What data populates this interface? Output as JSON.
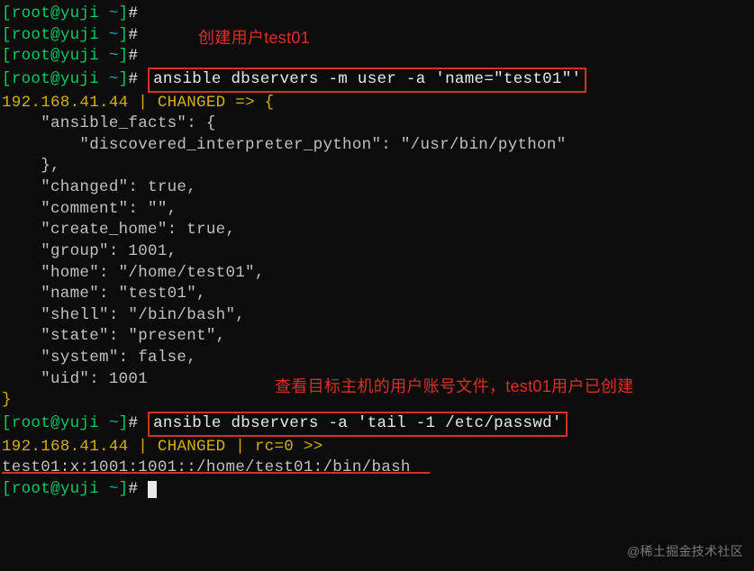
{
  "prompt": {
    "bracket_open": "[",
    "user_host": "root@yuji",
    "path": " ~",
    "bracket_close": "]",
    "hash": "# "
  },
  "annotations": {
    "create_user": "创建用户test01",
    "check_passwd": "查看目标主机的用户账号文件，test01用户已创建"
  },
  "commands": {
    "cmd1": "ansible dbservers -m user -a 'name=\"test01\"'",
    "cmd2": "ansible dbservers -a 'tail -1 /etc/passwd'"
  },
  "output": {
    "host1": "192.168.41.44",
    "pipe": " | ",
    "changed_arrow": "CHANGED",
    "arrow": " => {",
    "facts_key": "    \"ansible_facts\": {",
    "interpreter": "        \"discovered_interpreter_python\": \"/usr/bin/python\"",
    "close_brace1": "    },",
    "changed": "    \"changed\": true,",
    "comment": "    \"comment\": \"\",",
    "create_home": "    \"create_home\": true,",
    "group": "    \"group\": 1001,",
    "home": "    \"home\": \"/home/test01\",",
    "name": "    \"name\": \"test01\",",
    "shell": "    \"shell\": \"/bin/bash\",",
    "state": "    \"state\": \"present\",",
    "system": "    \"system\": false,",
    "uid": "    \"uid\": 1001",
    "close_brace2": "}",
    "changed2": "CHANGED | rc=0 >>",
    "passwd_line": "test01:x:1001:1001::/home/test01:/bin/bash"
  },
  "watermark": "@稀土掘金技术社区"
}
